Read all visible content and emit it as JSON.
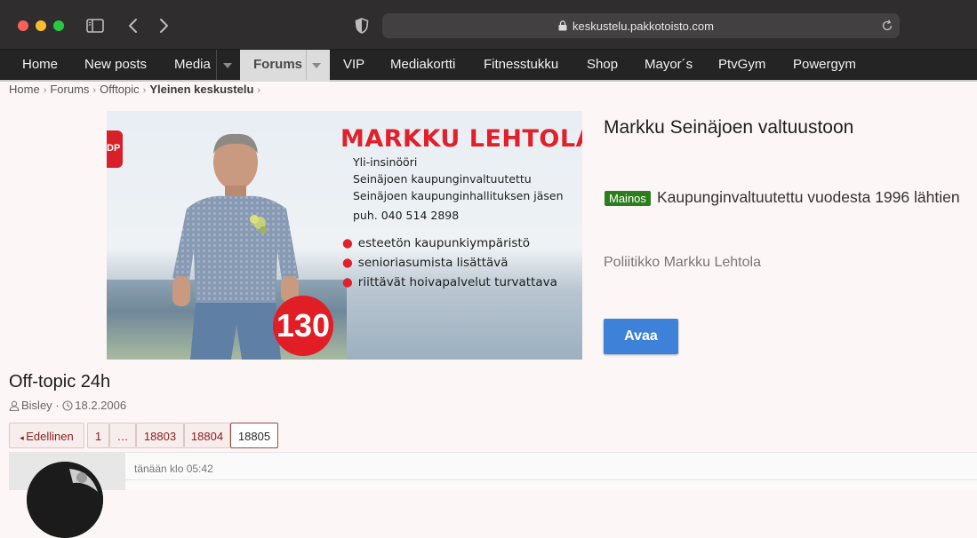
{
  "browser": {
    "url": "keskustelu.pakkotoisto.com"
  },
  "nav": {
    "items": [
      "Home",
      "New posts",
      "Media",
      "Forums",
      "VIP",
      "Mediakortti",
      "Fitnesstukku",
      "Shop",
      "Mayor´s",
      "PtvGym",
      "Powergym"
    ],
    "active": "Forums"
  },
  "breadcrumb": [
    "Home",
    "Forums",
    "Offtopic",
    "Yleinen keskustelu"
  ],
  "ad": {
    "image": {
      "name": "MARKKU LEHTOLA",
      "lines": [
        "Yli-insinööri",
        "Seinäjoen kaupunginvaltuutettu",
        "Seinäjoen kaupunginhallituksen jäsen",
        "puh. 040 514 2898"
      ],
      "bullets": [
        "esteetön kaupunkiympäristö",
        "senioriasumista lisättävä",
        "riittävät hoivapalvelut turvattava"
      ],
      "number": "130",
      "party_badge": "DP"
    },
    "title": "Markku Seinäjoen valtuustoon",
    "label": "Mainos",
    "description": "Kaupunginvaltuutettu vuodesta 1996 lähtien",
    "advertiser": "Poliitikko Markku Lehtola",
    "button": "Avaa"
  },
  "thread": {
    "title": "Off-topic 24h",
    "author": "Bisley",
    "date": "18.2.2006"
  },
  "pagination": {
    "prev": "Edellinen",
    "pages": [
      "1",
      "…",
      "18803",
      "18804",
      "18805"
    ],
    "current": "18805"
  },
  "post": {
    "time": "tänään klo 05:42"
  },
  "colors": {
    "nav_bg": "#242424",
    "ad_red": "#e0202a",
    "ad_label_green": "#2c7d1e",
    "button_blue": "#3d82d8",
    "page_text": "#8a1c1c"
  }
}
